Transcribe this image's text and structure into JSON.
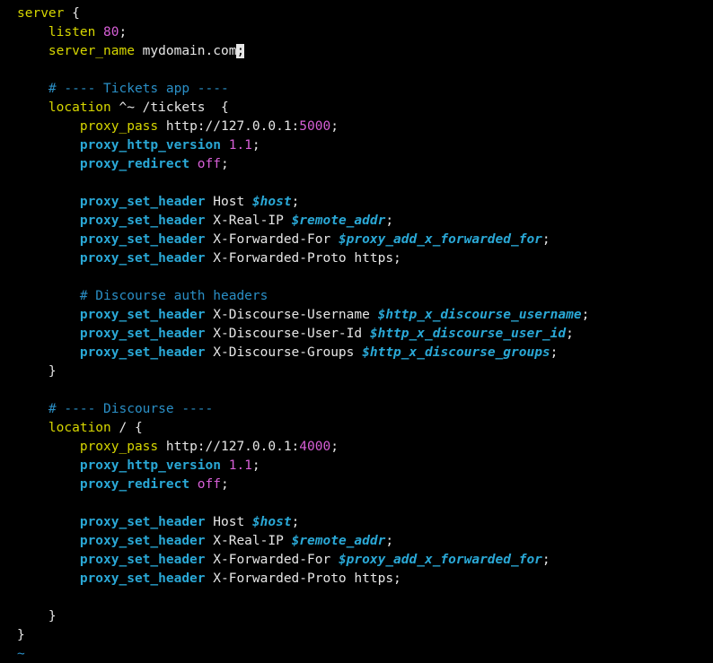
{
  "lines": [
    {
      "tokens": [
        {
          "c": "kw",
          "t": "server"
        },
        {
          "c": "txt",
          "t": " {"
        }
      ]
    },
    {
      "tokens": [
        {
          "c": "txt",
          "t": "    "
        },
        {
          "c": "kw",
          "t": "listen"
        },
        {
          "c": "txt",
          "t": " "
        },
        {
          "c": "num",
          "t": "80"
        },
        {
          "c": "txt",
          "t": ";"
        }
      ]
    },
    {
      "tokens": [
        {
          "c": "txt",
          "t": "    "
        },
        {
          "c": "kw",
          "t": "server_name"
        },
        {
          "c": "txt",
          "t": " mydomain.com"
        },
        {
          "c": "cursor",
          "t": ";"
        }
      ]
    },
    {
      "tokens": []
    },
    {
      "tokens": [
        {
          "c": "txt",
          "t": "    "
        },
        {
          "c": "cmt",
          "t": "# ---- Tickets app ----"
        }
      ]
    },
    {
      "tokens": [
        {
          "c": "txt",
          "t": "    "
        },
        {
          "c": "kw",
          "t": "location"
        },
        {
          "c": "txt",
          "t": " ^~ /tickets  {"
        }
      ]
    },
    {
      "tokens": [
        {
          "c": "txt",
          "t": "        "
        },
        {
          "c": "kw",
          "t": "proxy_pass"
        },
        {
          "c": "txt",
          "t": " http://127.0.0.1:"
        },
        {
          "c": "num",
          "t": "5000"
        },
        {
          "c": "txt",
          "t": ";"
        }
      ]
    },
    {
      "tokens": [
        {
          "c": "txt",
          "t": "        "
        },
        {
          "c": "dir",
          "t": "proxy_http_version"
        },
        {
          "c": "txt",
          "t": " "
        },
        {
          "c": "num",
          "t": "1.1"
        },
        {
          "c": "txt",
          "t": ";"
        }
      ]
    },
    {
      "tokens": [
        {
          "c": "txt",
          "t": "        "
        },
        {
          "c": "dir",
          "t": "proxy_redirect"
        },
        {
          "c": "txt",
          "t": " "
        },
        {
          "c": "num",
          "t": "off"
        },
        {
          "c": "txt",
          "t": ";"
        }
      ]
    },
    {
      "tokens": []
    },
    {
      "tokens": [
        {
          "c": "txt",
          "t": "        "
        },
        {
          "c": "dir",
          "t": "proxy_set_header"
        },
        {
          "c": "txt",
          "t": " Host "
        },
        {
          "c": "var",
          "t": "$host"
        },
        {
          "c": "txt",
          "t": ";"
        }
      ]
    },
    {
      "tokens": [
        {
          "c": "txt",
          "t": "        "
        },
        {
          "c": "dir",
          "t": "proxy_set_header"
        },
        {
          "c": "txt",
          "t": " X-Real-IP "
        },
        {
          "c": "var",
          "t": "$remote_addr"
        },
        {
          "c": "txt",
          "t": ";"
        }
      ]
    },
    {
      "tokens": [
        {
          "c": "txt",
          "t": "        "
        },
        {
          "c": "dir",
          "t": "proxy_set_header"
        },
        {
          "c": "txt",
          "t": " X-Forwarded-For "
        },
        {
          "c": "var",
          "t": "$proxy_add_x_forwarded_for"
        },
        {
          "c": "txt",
          "t": ";"
        }
      ]
    },
    {
      "tokens": [
        {
          "c": "txt",
          "t": "        "
        },
        {
          "c": "dir",
          "t": "proxy_set_header"
        },
        {
          "c": "txt",
          "t": " X-Forwarded-Proto https;"
        }
      ]
    },
    {
      "tokens": []
    },
    {
      "tokens": [
        {
          "c": "txt",
          "t": "        "
        },
        {
          "c": "cmt",
          "t": "# Discourse auth headers"
        }
      ]
    },
    {
      "tokens": [
        {
          "c": "txt",
          "t": "        "
        },
        {
          "c": "dir",
          "t": "proxy_set_header"
        },
        {
          "c": "txt",
          "t": " X-Discourse-Username "
        },
        {
          "c": "var",
          "t": "$http_x_discourse_username"
        },
        {
          "c": "txt",
          "t": ";"
        }
      ]
    },
    {
      "tokens": [
        {
          "c": "txt",
          "t": "        "
        },
        {
          "c": "dir",
          "t": "proxy_set_header"
        },
        {
          "c": "txt",
          "t": " X-Discourse-User-Id "
        },
        {
          "c": "var",
          "t": "$http_x_discourse_user_id"
        },
        {
          "c": "txt",
          "t": ";"
        }
      ]
    },
    {
      "tokens": [
        {
          "c": "txt",
          "t": "        "
        },
        {
          "c": "dir",
          "t": "proxy_set_header"
        },
        {
          "c": "txt",
          "t": " X-Discourse-Groups "
        },
        {
          "c": "var",
          "t": "$http_x_discourse_groups"
        },
        {
          "c": "txt",
          "t": ";"
        }
      ]
    },
    {
      "tokens": [
        {
          "c": "txt",
          "t": "    }"
        }
      ]
    },
    {
      "tokens": []
    },
    {
      "tokens": [
        {
          "c": "txt",
          "t": "    "
        },
        {
          "c": "cmt",
          "t": "# ---- Discourse ----"
        }
      ]
    },
    {
      "tokens": [
        {
          "c": "txt",
          "t": "    "
        },
        {
          "c": "kw",
          "t": "location"
        },
        {
          "c": "txt",
          "t": " / {"
        }
      ]
    },
    {
      "tokens": [
        {
          "c": "txt",
          "t": "        "
        },
        {
          "c": "kw",
          "t": "proxy_pass"
        },
        {
          "c": "txt",
          "t": " http://127.0.0.1:"
        },
        {
          "c": "num",
          "t": "4000"
        },
        {
          "c": "txt",
          "t": ";"
        }
      ]
    },
    {
      "tokens": [
        {
          "c": "txt",
          "t": "        "
        },
        {
          "c": "dir",
          "t": "proxy_http_version"
        },
        {
          "c": "txt",
          "t": " "
        },
        {
          "c": "num",
          "t": "1.1"
        },
        {
          "c": "txt",
          "t": ";"
        }
      ]
    },
    {
      "tokens": [
        {
          "c": "txt",
          "t": "        "
        },
        {
          "c": "dir",
          "t": "proxy_redirect"
        },
        {
          "c": "txt",
          "t": " "
        },
        {
          "c": "num",
          "t": "off"
        },
        {
          "c": "txt",
          "t": ";"
        }
      ]
    },
    {
      "tokens": []
    },
    {
      "tokens": [
        {
          "c": "txt",
          "t": "        "
        },
        {
          "c": "dir",
          "t": "proxy_set_header"
        },
        {
          "c": "txt",
          "t": " Host "
        },
        {
          "c": "var",
          "t": "$host"
        },
        {
          "c": "txt",
          "t": ";"
        }
      ]
    },
    {
      "tokens": [
        {
          "c": "txt",
          "t": "        "
        },
        {
          "c": "dir",
          "t": "proxy_set_header"
        },
        {
          "c": "txt",
          "t": " X-Real-IP "
        },
        {
          "c": "var",
          "t": "$remote_addr"
        },
        {
          "c": "txt",
          "t": ";"
        }
      ]
    },
    {
      "tokens": [
        {
          "c": "txt",
          "t": "        "
        },
        {
          "c": "dir",
          "t": "proxy_set_header"
        },
        {
          "c": "txt",
          "t": " X-Forwarded-For "
        },
        {
          "c": "var",
          "t": "$proxy_add_x_forwarded_for"
        },
        {
          "c": "txt",
          "t": ";"
        }
      ]
    },
    {
      "tokens": [
        {
          "c": "txt",
          "t": "        "
        },
        {
          "c": "dir",
          "t": "proxy_set_header"
        },
        {
          "c": "txt",
          "t": " X-Forwarded-Proto https;"
        }
      ]
    },
    {
      "tokens": []
    },
    {
      "tokens": [
        {
          "c": "txt",
          "t": "    }"
        }
      ]
    },
    {
      "tokens": [
        {
          "c": "txt",
          "t": "}"
        }
      ]
    },
    {
      "tokens": [
        {
          "c": "tilde",
          "t": "~"
        }
      ]
    }
  ],
  "colors": {
    "background": "#000000",
    "directive_yellow": "#d7d700",
    "directive_blue": "#2aa8d6",
    "number_magenta": "#d75fd7",
    "comment_blue": "#2a8fc6",
    "text": "#e6e6e6"
  }
}
